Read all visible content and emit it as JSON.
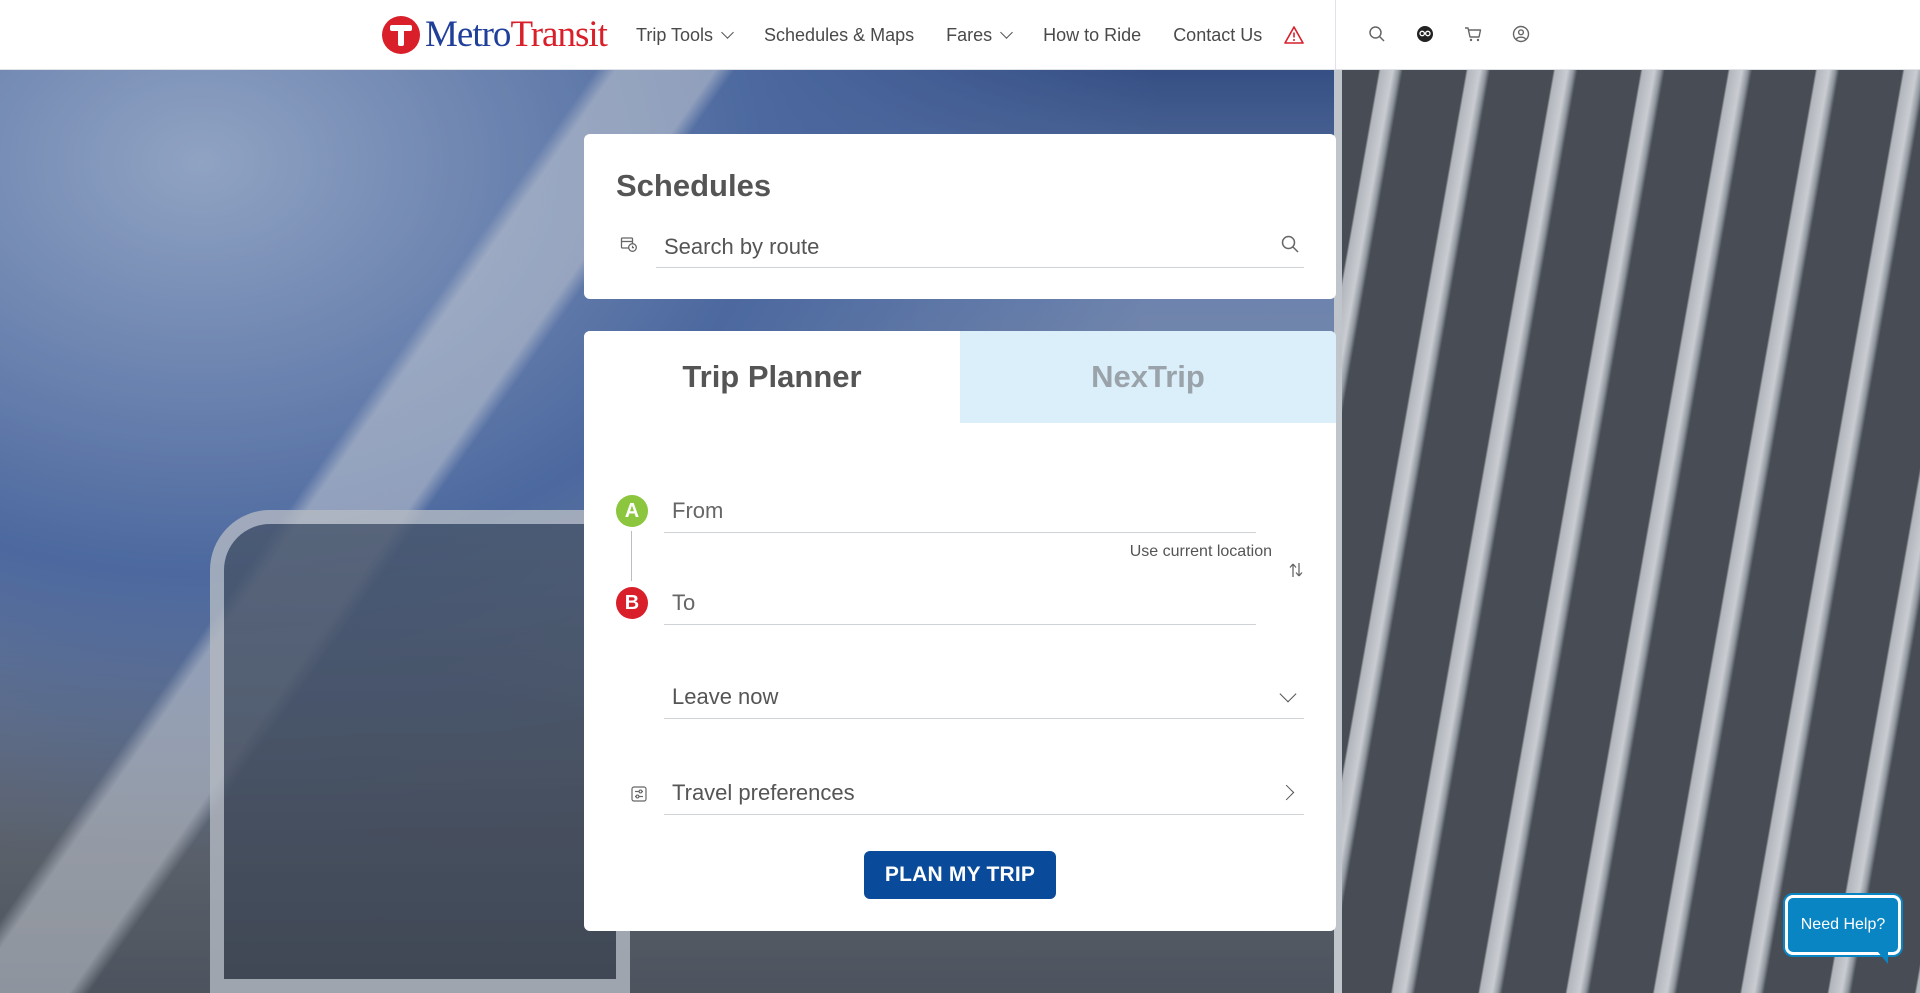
{
  "brand": {
    "metro": "Metro",
    "transit": "Transit",
    "red": "#d81f2a",
    "blue": "#1f3f99"
  },
  "nav": {
    "items": [
      {
        "label": "Trip Tools",
        "dropdown": true
      },
      {
        "label": "Schedules & Maps",
        "dropdown": false
      },
      {
        "label": "Fares",
        "dropdown": true
      },
      {
        "label": "How to Ride",
        "dropdown": false
      },
      {
        "label": "Contact Us",
        "dropdown": false
      }
    ],
    "icons": [
      "alert-icon",
      "search-icon",
      "go-to-card-icon",
      "cart-icon",
      "account-icon"
    ]
  },
  "schedules": {
    "title": "Schedules",
    "search_placeholder": "Search by route"
  },
  "trip_planner": {
    "tabs": [
      {
        "label": "Trip Planner",
        "active": true
      },
      {
        "label": "NexTrip",
        "active": false
      }
    ],
    "marker_a": "A",
    "marker_b": "B",
    "from_placeholder": "From",
    "to_placeholder": "To",
    "use_current_location": "Use current location",
    "leave_option": "Leave now",
    "travel_preferences": "Travel preferences",
    "plan_button": "PLAN MY TRIP",
    "button_color": "#0a4a9a"
  },
  "help": {
    "label": "Need Help?",
    "color": "#0a85c4"
  }
}
